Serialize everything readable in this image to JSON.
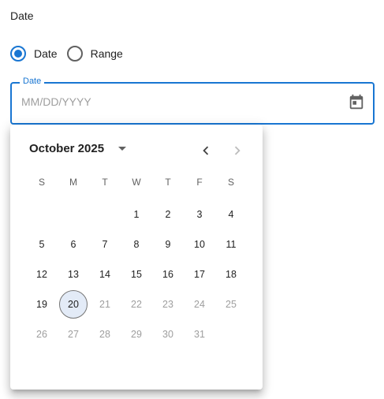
{
  "section_title": "Date",
  "mode": {
    "options": [
      {
        "label": "Date",
        "checked": true
      },
      {
        "label": "Range",
        "checked": false
      }
    ]
  },
  "field": {
    "label": "Date",
    "value": "",
    "placeholder": "MM/DD/YYYY",
    "icon": "calendar-icon"
  },
  "calendar": {
    "month_label": "October 2025",
    "prev_icon": "chevron-left-icon",
    "next_icon": "chevron-right-icon",
    "weekdays": [
      "S",
      "M",
      "T",
      "W",
      "T",
      "F",
      "S"
    ],
    "weeks": [
      [
        "",
        "",
        "",
        "1",
        "2",
        "3",
        "4"
      ],
      [
        "5",
        "6",
        "7",
        "8",
        "9",
        "10",
        "11"
      ],
      [
        "12",
        "13",
        "14",
        "15",
        "16",
        "17",
        "18"
      ],
      [
        "19",
        "20",
        "21",
        "22",
        "23",
        "24",
        "25"
      ],
      [
        "26",
        "27",
        "28",
        "29",
        "30",
        "31",
        ""
      ]
    ],
    "today": "20",
    "first_disabled": "21"
  },
  "colors": {
    "accent": "#1976d2",
    "today_fill": "#e3ebf7",
    "disabled_text": "#9e9e9e"
  }
}
